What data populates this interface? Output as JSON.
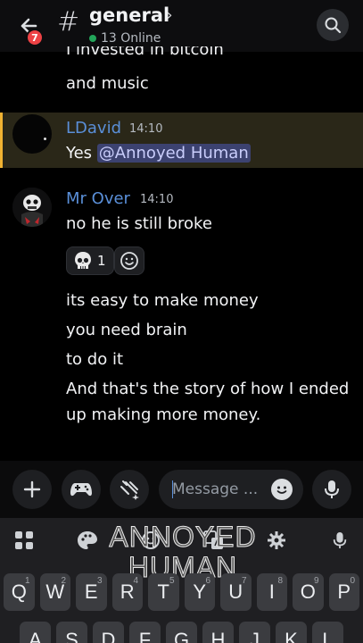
{
  "header": {
    "channel_name": "general",
    "online_text": "13 Online",
    "badge_count": "7"
  },
  "messages": {
    "cut_line": "I invested in bitcoin",
    "line_music": "and music",
    "msg1": {
      "author": "LDavid",
      "time": "14:10",
      "prefix": "Yes",
      "mention": "@Annoyed Human"
    },
    "msg2": {
      "author": "Mr Over",
      "time": "14:10",
      "lines": [
        "no he is still broke",
        "its easy to make money",
        "you need brain",
        "to do it",
        "And that's the story of how I ended",
        "up making more money."
      ],
      "reaction": {
        "emoji": "skull-icon",
        "count": "1"
      }
    }
  },
  "composer": {
    "placeholder": "Message ..."
  },
  "keyboard": {
    "overlay_text": [
      "ANNOYED",
      "HUMAN"
    ],
    "row1": [
      "Q",
      "W",
      "E",
      "R",
      "T",
      "Y",
      "U",
      "I",
      "O",
      "P"
    ],
    "row1_sup": [
      "1",
      "2",
      "3",
      "4",
      "5",
      "6",
      "7",
      "8",
      "9",
      "0"
    ],
    "row2": [
      "A",
      "S",
      "D",
      "F",
      "G",
      "H",
      "J",
      "K",
      "L"
    ]
  },
  "colors": {
    "accent": "#5a8fd8",
    "mention_bg": "#3c4270",
    "highlight_border": "#f0b232",
    "online": "#23a55a",
    "badge": "#ed4245"
  }
}
